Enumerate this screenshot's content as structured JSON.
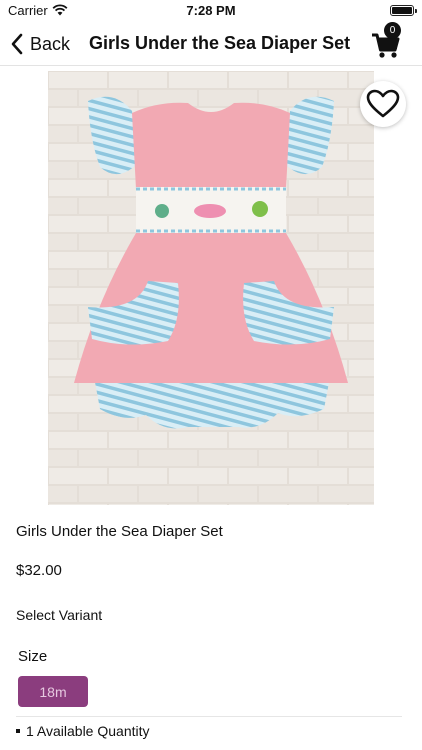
{
  "status_bar": {
    "carrier": "Carrier",
    "time": "7:28 PM"
  },
  "nav": {
    "back_label": "Back",
    "title": "Girls Under the Sea Diaper Set",
    "cart_count": "0"
  },
  "product": {
    "name": "Girls Under the Sea Diaper Set",
    "price": "$32.00",
    "select_variant_label": "Select Variant",
    "size_label": "Size",
    "size_options": [
      "18m"
    ],
    "selected_size": "18m",
    "quantity_text": "1 Available Quantity"
  },
  "colors": {
    "size_chip_bg": "#8b3d7e",
    "size_chip_text": "#e6c9e0",
    "dress_pink": "#f2a9b3",
    "stripe_blue": "#9fcfe3"
  },
  "icons": {
    "back": "chevron-left-icon",
    "cart": "cart-icon",
    "favorite": "heart-outline-icon"
  }
}
